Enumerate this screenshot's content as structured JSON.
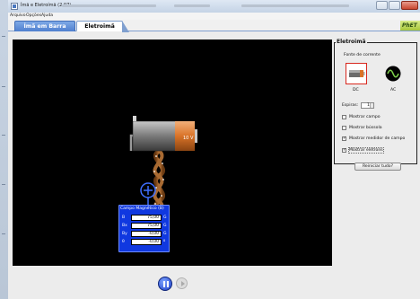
{
  "window": {
    "title": "Ímã e Eletroímã (2.07)"
  },
  "menu": {
    "items": [
      "Arquivo",
      "Opções",
      "Ajuda"
    ]
  },
  "tabs": [
    {
      "label": "Ímã em Barra",
      "active": false
    },
    {
      "label": "Eletroimã",
      "active": true
    }
  ],
  "logo": "PhET",
  "battery": {
    "voltage_label": "10 V"
  },
  "field_meter": {
    "title": "Campo Magnético (B)",
    "rows": [
      {
        "label": "B",
        "value": "75,00",
        "unit": "G"
      },
      {
        "label": "Bx",
        "value": "75,00",
        "unit": "G"
      },
      {
        "label": "By",
        "value": "-0,00",
        "unit": "G"
      },
      {
        "label": "θ",
        "value": "-0,00",
        "unit": "º"
      }
    ]
  },
  "controls": {
    "group_title": "Eletroimã",
    "current_source_label": "Fonte de corrente",
    "dc_label": "DC",
    "ac_label": "AC",
    "selected_source": "DC",
    "loops_label": "Espiras:",
    "loops_value": "1",
    "checkboxes": [
      {
        "label": "Mostrar campo",
        "checked": false
      },
      {
        "label": "Mostrar bússola",
        "checked": false
      },
      {
        "label": "Mostrar medidor de campo",
        "checked": true
      },
      {
        "label": "Mostrar elétrons",
        "checked": true
      }
    ],
    "reset_label": "Reiniciar tudo?"
  },
  "colors": {
    "canvas_bg": "#000000",
    "meter_bg": "#1038e0",
    "tab_active": "#ffffff",
    "tab_inactive": "#5a8ad8",
    "dc_selected_border": "#d8281e"
  },
  "playback": {
    "play_icon": "pause-icon",
    "step_icon": "step-icon"
  }
}
